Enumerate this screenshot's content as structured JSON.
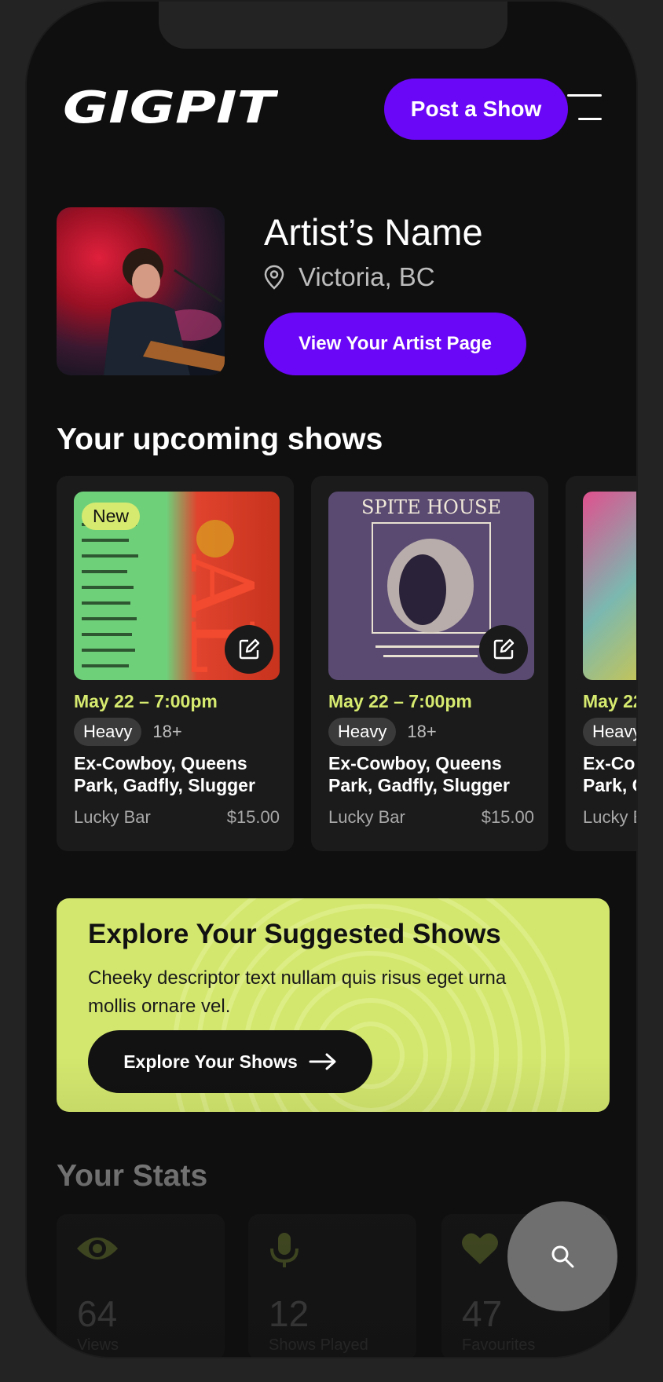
{
  "header": {
    "logo_text": "GIGPIT",
    "post_button": "Post a Show",
    "menu_icon": "hamburger-menu-icon"
  },
  "artist": {
    "name": "Artist’s Name",
    "location": "Victoria, BC",
    "location_icon": "map-pin-icon",
    "view_button": "View Your Artist Page"
  },
  "upcoming": {
    "title": "Your upcoming shows",
    "shows": [
      {
        "badge": "New",
        "date": "May 22 – 7:00pm",
        "genre": "Heavy",
        "age": "18+",
        "title": "Ex-Cowboy, Queens Park, Gadfly, Slugger",
        "venue": "Lucky Bar",
        "price": "$15.00",
        "edit_icon": "edit-icon",
        "poster_accent": "#6fd07a"
      },
      {
        "badge": "",
        "date": "May 22 – 7:00pm",
        "genre": "Heavy",
        "age": "18+",
        "title": "Ex-Cowboy, Queens Park, Gadfly, Slugger",
        "venue": "Lucky Bar",
        "price": "$15.00",
        "poster_title": "SPITE HOUSE",
        "edit_icon": "edit-icon",
        "poster_accent": "#5a4a72"
      },
      {
        "badge": "",
        "date": "May 22",
        "genre": "Heavy",
        "age": "",
        "title": "Ex-Co",
        "title2": "Park, C",
        "venue": "Lucky B",
        "price": "",
        "poster_accent": "#7bb8b0"
      }
    ]
  },
  "explore": {
    "title": "Explore Your Suggested Shows",
    "description": "Cheeky descriptor text nullam quis risus eget urna mollis ornare vel.",
    "button": "Explore Your Shows",
    "button_icon": "arrow-right-icon",
    "background": "#d3e76e"
  },
  "stats": {
    "title": "Your Stats",
    "items": [
      {
        "icon": "eye-icon",
        "value": "64",
        "label": "Views"
      },
      {
        "icon": "microphone-icon",
        "value": "12",
        "label": "Shows Played"
      },
      {
        "icon": "heart-icon",
        "value": "47",
        "label": "Favourites"
      }
    ]
  },
  "fab": {
    "icon": "search-icon"
  },
  "colors": {
    "brand_purple": "#6a07f6",
    "accent_lime": "#d6ea6f",
    "background": "#0f0f0f"
  }
}
